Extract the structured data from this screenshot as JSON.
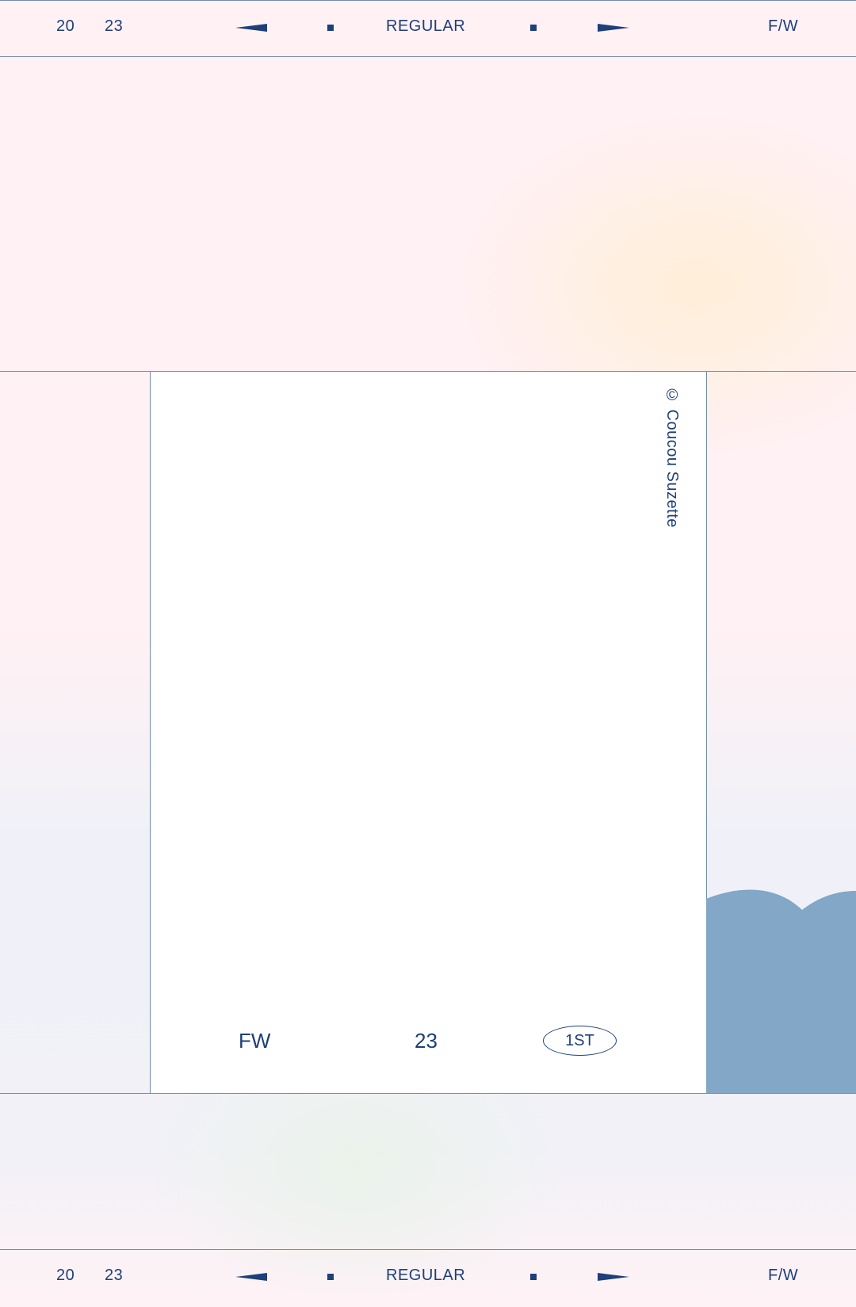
{
  "header": {
    "year_first": "20",
    "year_second": "23",
    "category": "REGULAR",
    "season": "F/W"
  },
  "footer": {
    "year_first": "20",
    "year_second": "23",
    "category": "REGULAR",
    "season": "F/W"
  },
  "card": {
    "credit": "© Coucou Suzette",
    "season_code": "FW",
    "year": "23",
    "badge": "1ST"
  },
  "colors": {
    "ink": "#1d3f7a",
    "line": "#6f8cad",
    "hills": "#82a7c7",
    "card": "#ffffff"
  },
  "icons": {
    "left_arrow": "left-wedge-arrow-icon",
    "right_arrow": "right-wedge-arrow-icon",
    "separator": "square-dot-icon"
  }
}
